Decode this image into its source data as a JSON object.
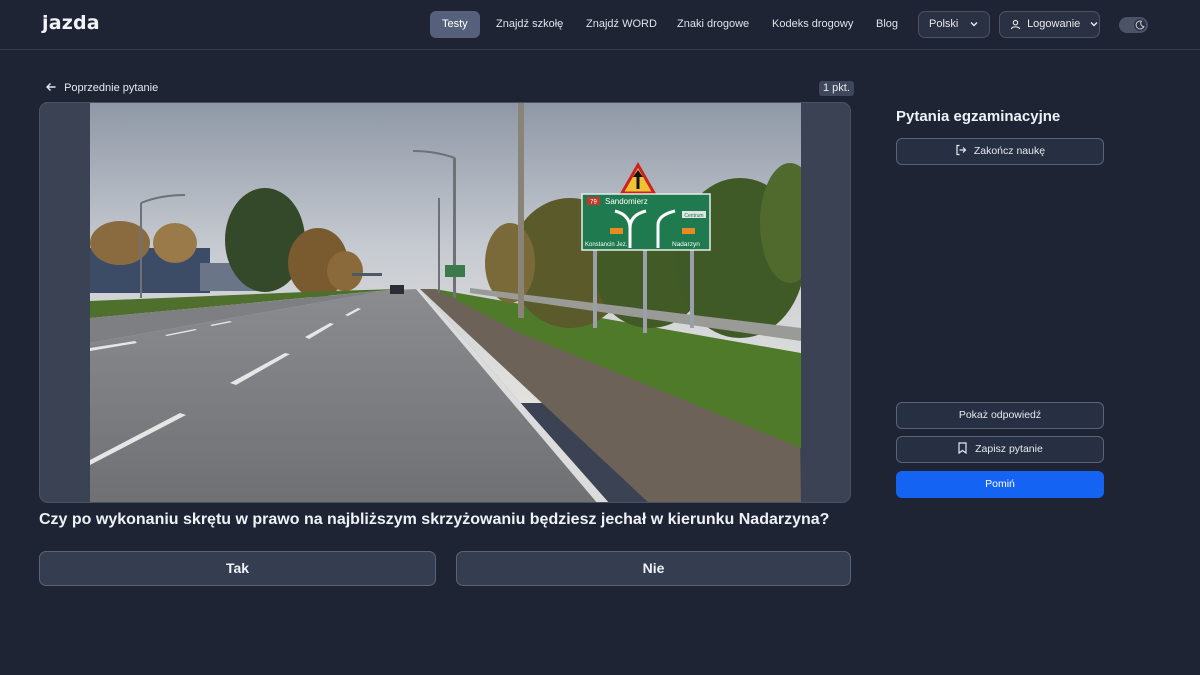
{
  "header": {
    "logo": "jazda",
    "nav": [
      {
        "label": "Testy",
        "active": true
      },
      {
        "label": "Znajdź szkołę"
      },
      {
        "label": "Znajdź WORD"
      },
      {
        "label": "Znaki drogowe"
      },
      {
        "label": "Kodeks drogowy"
      },
      {
        "label": "Blog"
      }
    ],
    "language_label": "Polski",
    "login_label": "Logowanie",
    "theme_toggle_icon": "moon-icon"
  },
  "main": {
    "prev_link": "Poprzednie pytanie",
    "points": "1 pkt.",
    "question": "Czy po wykonaniu skrętu w prawo na najbliższym skrzyżowaniu będziesz jechał w kierunku Nadarzyna?",
    "answers": [
      "Tak",
      "Nie"
    ],
    "sign": {
      "road_number_top": "79",
      "top_destination": "Sandomierz",
      "left_destination": "Konstancin Jez.",
      "right_destination": "Nadarzyn",
      "centrum": "Centrum",
      "left_number": "",
      "right_number": ""
    }
  },
  "sidebar": {
    "title": "Pytania egzaminacyjne",
    "end_button": "Zakończ naukę",
    "show_answer_button": "Pokaż odpowiedź",
    "save_button": "Zapisz pytanie",
    "skip_button": "Pomiń"
  },
  "colors": {
    "background": "#1e2434",
    "accent": "#1463f3",
    "sign_green": "#1f7a4f"
  }
}
